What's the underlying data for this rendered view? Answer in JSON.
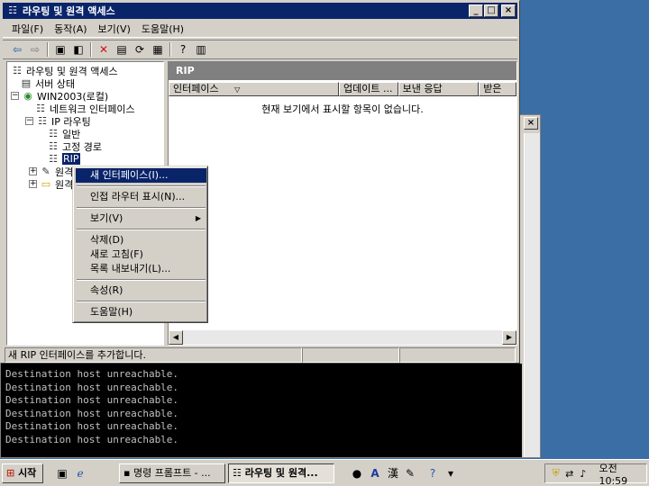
{
  "window": {
    "title": "라우팅 및 원격 액세스",
    "minimize": "_",
    "maximize": "□",
    "close": "×"
  },
  "menubar": [
    "파일(F)",
    "동작(A)",
    "보기(V)",
    "도움말(H)"
  ],
  "toolbar": {
    "back_icon": "back-arrow-icon",
    "forward_icon": "forward-arrow-icon",
    "up_icon": "up-folder-icon",
    "show_hide_tree_icon": "tree-toggle-icon",
    "delete_icon": "delete-icon",
    "properties_icon": "properties-icon",
    "refresh_icon": "refresh-icon",
    "export_icon": "export-list-icon",
    "help_icon": "help-icon",
    "console_icon": "mmc-console-icon"
  },
  "tree": {
    "root": "라우팅 및 원격 액세스",
    "server_status": "서버 상태",
    "server": "WIN2003(로컬)",
    "network_interfaces": "네트워크 인터페이스",
    "ip_routing": "IP 라우팅",
    "general": "일반",
    "static_routes": "고정 경로",
    "rip": "RIP",
    "remote_1": "원격",
    "remote_2": "원격"
  },
  "right_pane": {
    "header": "RIP",
    "columns": [
      "인터페이스",
      "업데이트 ...",
      "보낸 응답",
      "받은"
    ],
    "empty_message": "현재 보기에서 표시할 항목이 없습니다."
  },
  "status_text": "새 RIP 인터페이스를 추가합니다.",
  "context_menu": {
    "new_interface": "새 인터페이스(I)...",
    "show_neighbors": "인접 라우터 표시(N)...",
    "view": "보기(V)",
    "delete": "삭제(D)",
    "refresh": "새로 고침(F)",
    "export_list": "목록 내보내기(L)...",
    "properties": "속성(R)",
    "help": "도움말(H)"
  },
  "console": {
    "close": "×",
    "lines": "Destination host unreachable.\nDestination host unreachable.\nDestination host unreachable.\nDestination host unreachable.\nDestination host unreachable.\nDestination host unreachable."
  },
  "taskbar": {
    "start": "시작",
    "cmd_task": "명령 프롬프트 - ...",
    "mmc_task": "라우팅 및 원격...",
    "ime_a": "A",
    "ime_han": "漢",
    "clock": "오전 10:59"
  },
  "colors": {
    "desktop": "#3a6ea5",
    "title_active": "#0a246a",
    "face": "#d4d0c8",
    "pane_header": "#808080"
  }
}
